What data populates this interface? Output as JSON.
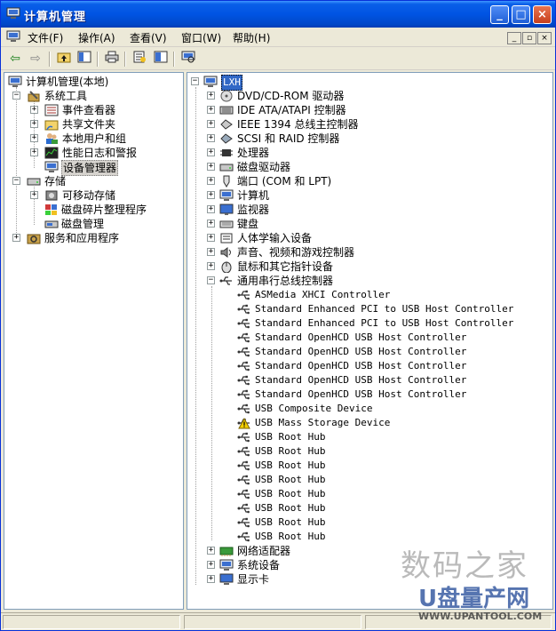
{
  "window": {
    "title": "计算机管理",
    "controls": [
      "minimize",
      "maximize",
      "close"
    ]
  },
  "menubar": {
    "items": [
      "文件(F)",
      "操作(A)",
      "查看(V)",
      "窗口(W)",
      "帮助(H)"
    ]
  },
  "toolbar": {
    "buttons": [
      "back-icon",
      "forward-icon",
      "up-icon",
      "show-hide-tree-icon",
      "print-icon",
      "properties-icon",
      "help-icon",
      "scan-hardware-icon"
    ]
  },
  "left_tree": {
    "root": "计算机管理(本地)",
    "groups": [
      {
        "label": "系统工具",
        "children": [
          "事件查看器",
          "共享文件夹",
          "本地用户和组",
          "性能日志和警报",
          "设备管理器"
        ]
      },
      {
        "label": "存储",
        "children": [
          "可移动存储",
          "磁盘碎片整理程序",
          "磁盘管理"
        ]
      },
      {
        "label": "服务和应用程序",
        "children": []
      }
    ],
    "selected": "设备管理器"
  },
  "right_tree": {
    "root": "LXH",
    "categories": [
      "DVD/CD-ROM 驱动器",
      "IDE ATA/ATAPI 控制器",
      "IEEE 1394 总线主控制器",
      "SCSI 和 RAID 控制器",
      "处理器",
      "磁盘驱动器",
      "端口 (COM 和 LPT)",
      "计算机",
      "监视器",
      "键盘",
      "人体学输入设备",
      "声音、视频和游戏控制器",
      "鼠标和其它指针设备",
      "通用串行总线控制器"
    ],
    "usb_children": [
      {
        "label": "ASMedia XHCI Controller",
        "warning": false
      },
      {
        "label": "Standard Enhanced PCI to USB Host Controller",
        "warning": false
      },
      {
        "label": "Standard Enhanced PCI to USB Host Controller",
        "warning": false
      },
      {
        "label": "Standard OpenHCD USB Host Controller",
        "warning": false
      },
      {
        "label": "Standard OpenHCD USB Host Controller",
        "warning": false
      },
      {
        "label": "Standard OpenHCD USB Host Controller",
        "warning": false
      },
      {
        "label": "Standard OpenHCD USB Host Controller",
        "warning": false
      },
      {
        "label": "Standard OpenHCD USB Host Controller",
        "warning": false
      },
      {
        "label": "USB Composite Device",
        "warning": false
      },
      {
        "label": "USB Mass Storage Device",
        "warning": true
      },
      {
        "label": "USB Root Hub",
        "warning": false
      },
      {
        "label": "USB Root Hub",
        "warning": false
      },
      {
        "label": "USB Root Hub",
        "warning": false
      },
      {
        "label": "USB Root Hub",
        "warning": false
      },
      {
        "label": "USB Root Hub",
        "warning": false
      },
      {
        "label": "USB Root Hub",
        "warning": false
      },
      {
        "label": "USB Root Hub",
        "warning": false
      },
      {
        "label": "USB Root Hub",
        "warning": false
      }
    ],
    "after_categories": [
      "网络适配器",
      "系统设备",
      "显示卡"
    ]
  },
  "watermark": {
    "line1": "数码之家",
    "line2": "U盘量产网",
    "line3": "WWW.UPANTOOL.COM"
  },
  "colors": {
    "titlebar": "#0054e3",
    "window_bg": "#ece9d8",
    "pane_border": "#7f9db9",
    "warning": "#f5d000"
  }
}
